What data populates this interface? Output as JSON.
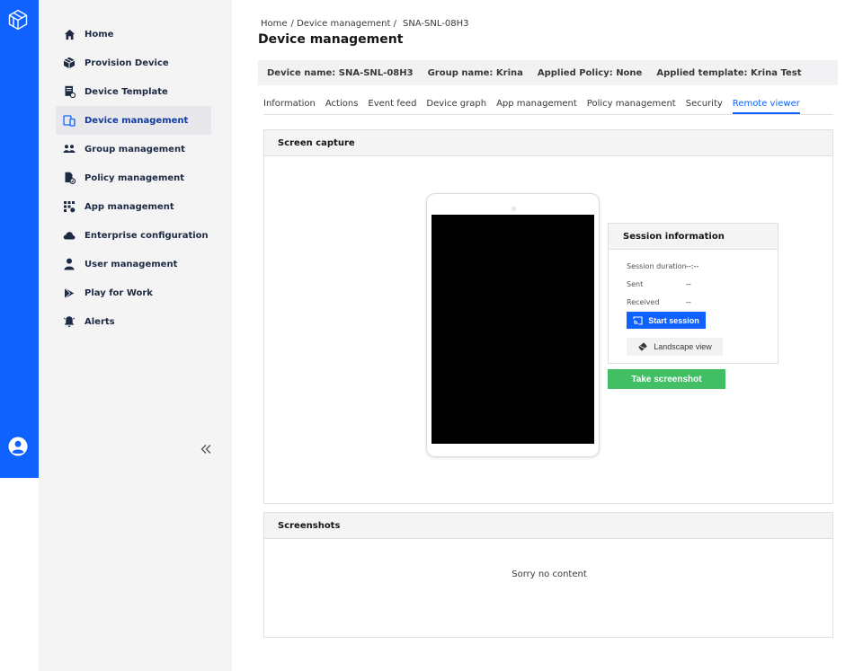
{
  "sidebar": {
    "items": [
      {
        "label": "Home"
      },
      {
        "label": "Provision Device"
      },
      {
        "label": "Device Template"
      },
      {
        "label": "Device management"
      },
      {
        "label": "Group management"
      },
      {
        "label": "Policy management"
      },
      {
        "label": "App management"
      },
      {
        "label": "Enterprise configuration"
      },
      {
        "label": "User management"
      },
      {
        "label": "Play for Work"
      },
      {
        "label": "Alerts"
      }
    ],
    "active_index": 3
  },
  "breadcrumb": {
    "home": "Home",
    "section": "/ Device management /",
    "device": "SNA-SNL-08H3"
  },
  "page": {
    "title": "Device management"
  },
  "info_bar": {
    "device_name": "Device name: SNA-SNL-08H3",
    "group_name": "Group name: Krina",
    "applied_policy": "Applied Policy: None",
    "applied_template": "Applied template: Krina Test"
  },
  "tabs": [
    {
      "label": "Information"
    },
    {
      "label": "Actions"
    },
    {
      "label": "Event feed"
    },
    {
      "label": "Device graph"
    },
    {
      "label": "App management"
    },
    {
      "label": "Policy management"
    },
    {
      "label": "Security"
    },
    {
      "label": "Remote viewer"
    }
  ],
  "screen_capture": {
    "title": "Screen capture",
    "session": {
      "title": "Session information",
      "duration_label": "Session duration",
      "duration_value": "--:--",
      "sent_label": "Sent",
      "sent_value": "--",
      "received_label": "Received",
      "received_value": "--",
      "start_label": "Start session",
      "landscape_label": "Landscape view"
    },
    "screenshot_label": "Take screenshot"
  },
  "screenshots": {
    "title": "Screenshots",
    "empty_text": "Sorry no content"
  },
  "colors": {
    "rail": "#0f62fe",
    "primary": "#0f62fe",
    "success": "#42be65",
    "sidebar_bg": "#f4f4f4"
  }
}
